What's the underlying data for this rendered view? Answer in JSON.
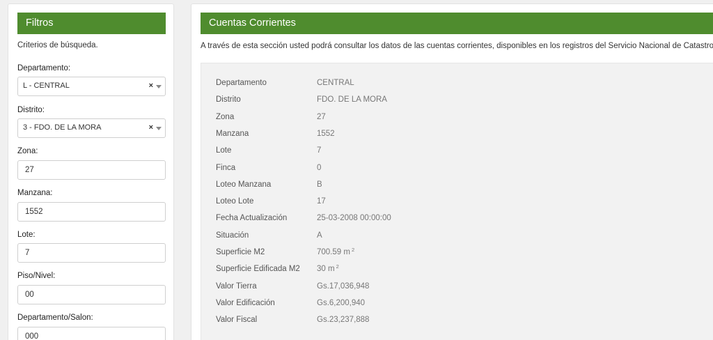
{
  "filters": {
    "header": "Filtros",
    "subtitle": "Criterios de búsqueda.",
    "fields": [
      {
        "label": "Departamento:",
        "value": "L - CENTRAL",
        "clear": "×"
      },
      {
        "label": "Distrito:",
        "value": "3 - FDO. DE LA MORA",
        "clear": "×"
      },
      {
        "label": "Zona:",
        "value": "27"
      },
      {
        "label": "Manzana:",
        "value": "1552"
      },
      {
        "label": "Lote:",
        "value": "7"
      },
      {
        "label": "Piso/Nivel:",
        "value": "00"
      },
      {
        "label": "Departamento/Salon:",
        "value": "000"
      }
    ]
  },
  "account": {
    "header": "Cuentas Corrientes",
    "description": "A través de esta sección usted podrá consultar los datos de las cuentas corrientes, disponibles en los registros del Servicio Nacional de Catastro.",
    "rows": [
      {
        "label": "Departamento",
        "value": "CENTRAL"
      },
      {
        "label": "Distrito",
        "value": "FDO. DE LA MORA"
      },
      {
        "label": "Zona",
        "value": "27"
      },
      {
        "label": "Manzana",
        "value": "1552"
      },
      {
        "label": "Lote",
        "value": "7"
      },
      {
        "label": "Finca",
        "value": "0"
      },
      {
        "label": "Loteo Manzana",
        "value": "B"
      },
      {
        "label": "Loteo Lote",
        "value": "17"
      },
      {
        "label": "Fecha Actualización",
        "value": "25-03-2008 00:00:00"
      },
      {
        "label": "Situación",
        "value": "A"
      },
      {
        "label": "Superficie M2",
        "value": "700.59 m",
        "sup": "2"
      },
      {
        "label": "Superficie Edificada M2",
        "value": "30 m",
        "sup": "2"
      },
      {
        "label": "Valor Tierra",
        "value": "Gs.17,036,948"
      },
      {
        "label": "Valor Edificación",
        "value": "Gs.6,200,940"
      },
      {
        "label": "Valor Fiscal",
        "value": "Gs.23,237,888"
      }
    ]
  },
  "colors": {
    "header_bg": "#4f8c2e",
    "header_text": "#ffffff",
    "details_bg": "#f2f2f2"
  }
}
